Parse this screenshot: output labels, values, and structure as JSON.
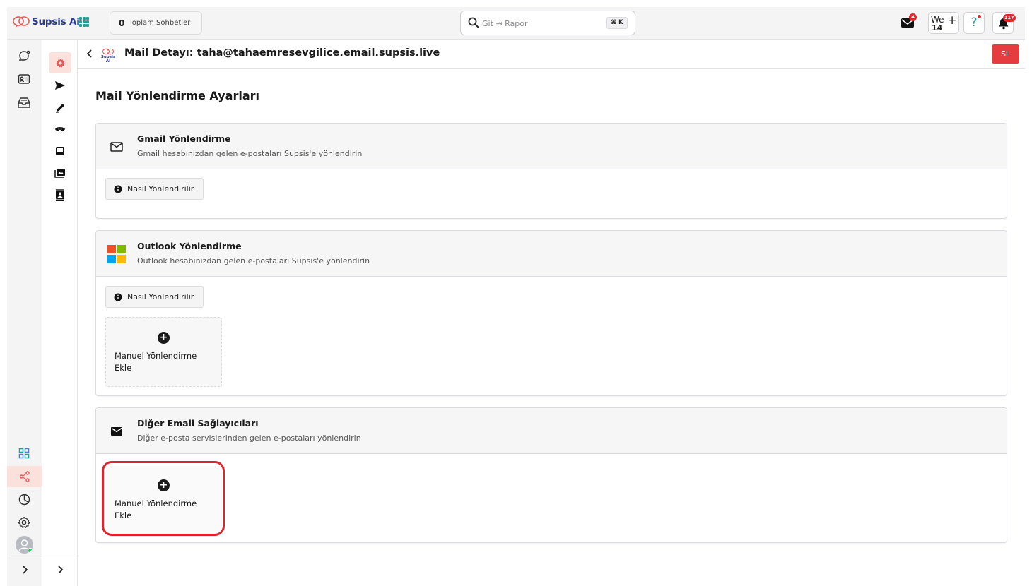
{
  "app": {
    "name": "Supsis Ai",
    "logo_small_text": "Supsis Ai"
  },
  "topbar": {
    "chat_count": "0",
    "chat_label": "Toplam Sohbetler",
    "search_placeholder": "Git ⇥ Rapor",
    "search_shortcut": "⌘ K",
    "mail_badge": "4",
    "week_label": "We",
    "week_number": "14",
    "help_label": "?",
    "notification_badge": "117"
  },
  "page": {
    "title": "Mail Detayı: taha@tahaemresevgilice.email.supsis.live",
    "delete_label": "Sil",
    "section_title": "Mail Yönlendirme Ayarları"
  },
  "cards": {
    "gmail": {
      "title": "Gmail Yönlendirme",
      "subtitle": "Gmail hesabınızdan gelen e-postaları Supsis'e yönlendirin",
      "how_label": "Nasıl Yönlendirilir"
    },
    "outlook": {
      "title": "Outlook Yönlendirme",
      "subtitle": "Outlook hesabınızdan gelen e-postaları Supsis'e yönlendirin",
      "how_label": "Nasıl Yönlendirilir",
      "add_label": "Manuel Yönlendirme Ekle"
    },
    "other": {
      "title": "Diğer Email Sağlayıcıları",
      "subtitle": "Diğer e-posta servislerinden gelen e-postaları yönlendirin",
      "add_label": "Manuel Yönlendirme Ekle"
    }
  },
  "colors": {
    "accent_red": "#e63c3f",
    "active_bg": "#fbe1dc",
    "brand_teal": "#16a394",
    "brand_blue": "#2a3a8f"
  },
  "icons": {
    "rail": [
      "chat-bubble-icon",
      "contact-card-icon",
      "inbox-tray-icon",
      "dashboard-grid-icon",
      "share-icon",
      "pie-chart-icon",
      "settings-gear-icon"
    ],
    "rail2": [
      "gear-icon",
      "send-icon",
      "edit-pen-icon",
      "eye-icon",
      "inbox-icon",
      "gallery-icon",
      "contacts-book-icon"
    ]
  }
}
